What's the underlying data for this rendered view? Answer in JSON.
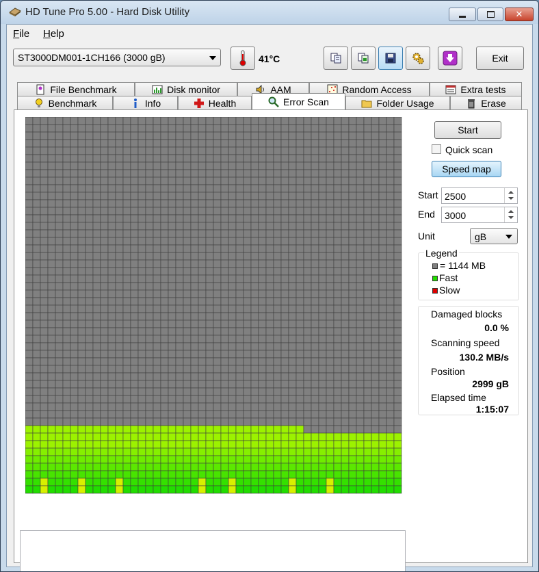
{
  "window": {
    "title": "HD Tune Pro 5.00 - Hard Disk Utility"
  },
  "menu": [
    {
      "label": "File",
      "underline": "F",
      "rest": "ile"
    },
    {
      "label": "Help",
      "underline": "H",
      "rest": "elp"
    }
  ],
  "toolbar": {
    "drive": "ST3000DM001-1CH166 (3000 gB)",
    "temperature": "41°C",
    "exit_label": "Exit"
  },
  "tabs_top": [
    "File Benchmark",
    "Disk monitor",
    "AAM",
    "Random Access",
    "Extra tests"
  ],
  "tabs_bottom": [
    "Benchmark",
    "Info",
    "Health",
    "Error Scan",
    "Folder Usage",
    "Erase"
  ],
  "selected_tab": "Error Scan",
  "controls": {
    "start_label": "Start",
    "quick_scan_label": "Quick scan",
    "quick_scan_checked": false,
    "speed_map_label": "Speed map",
    "start_field_label": "Start",
    "start_value": "2500",
    "end_field_label": "End",
    "end_value": "3000",
    "unit_label": "Unit",
    "unit_value": "gB"
  },
  "legend": {
    "title": "Legend",
    "block": "= 1144 MB",
    "fast": "Fast",
    "slow": "Slow",
    "colors": {
      "unscanned": "#808080",
      "fast": "#22dd00",
      "slow": "#dd0000"
    }
  },
  "stats": {
    "damaged_label": "Damaged blocks",
    "damaged_value": "0.0 %",
    "speed_label": "Scanning speed",
    "speed_value": "130.2 MB/s",
    "position_label": "Position",
    "position_value": "2999 gB",
    "elapsed_label": "Elapsed time",
    "elapsed_value": "1:15:07"
  },
  "scan_grid": {
    "columns": 50,
    "rows": 50,
    "scanned_blocks": 437
  }
}
